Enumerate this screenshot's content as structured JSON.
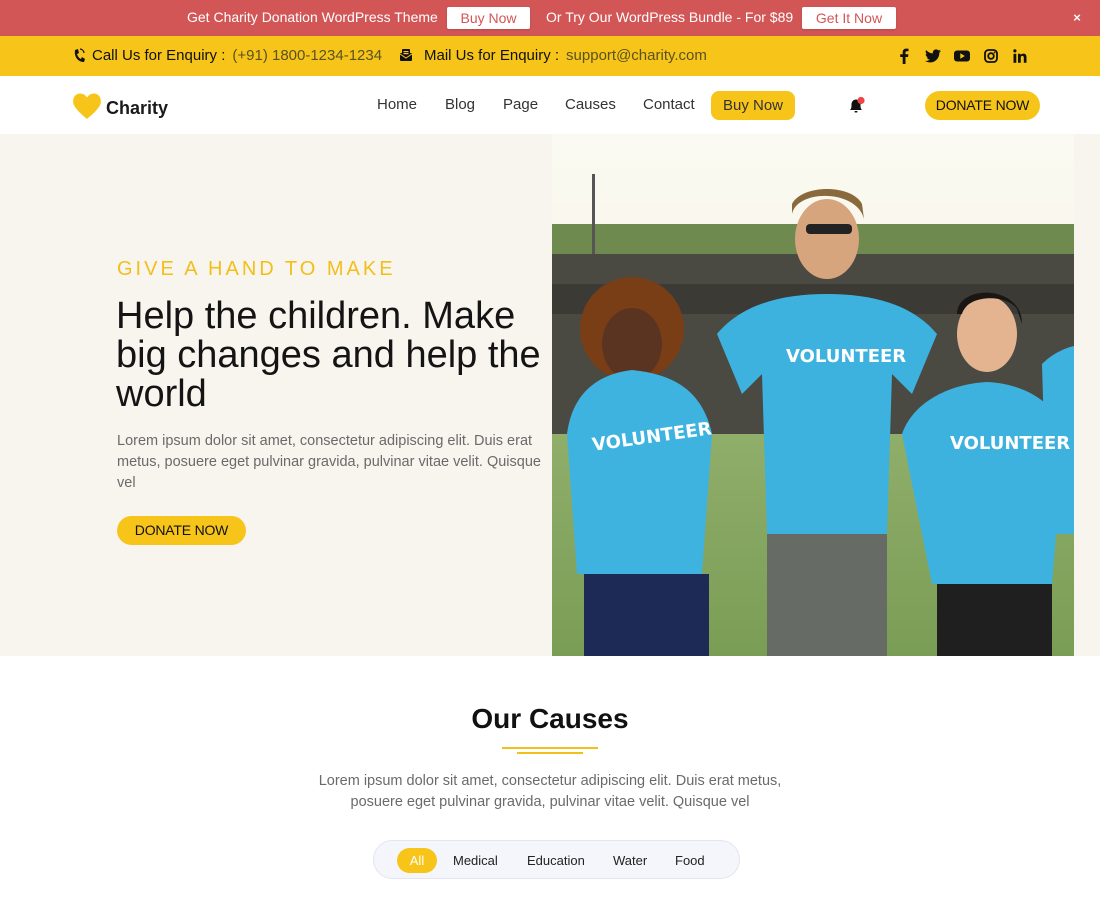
{
  "promo_bar": {
    "text1": "Get Charity Donation WordPress Theme",
    "button1": "Buy Now",
    "text2": "Or Try Our WordPress Bundle - For $89",
    "button2": "Get It Now",
    "close": "×",
    "background": "#d35657"
  },
  "contact_bar": {
    "phone_label": "Call Us for Enquiry :",
    "phone_value": "(+91) 1800-1234-1234",
    "phone_icon": "phone-icon",
    "mail_label": "Mail Us for Enquiry :",
    "mail_value": "support@charity.com",
    "mail_icon": "mail-icon",
    "socials": [
      "facebook-icon",
      "twitter-icon",
      "youtube-icon",
      "instagram-icon",
      "linkedin-icon"
    ],
    "background": "#f7c519"
  },
  "nav": {
    "logo_text": "Charity",
    "logo_icon": "heart-icon",
    "links": [
      "Home",
      "Blog",
      "Page",
      "Causes",
      "Contact"
    ],
    "buy_now": "Buy Now",
    "notification_icon": "bell-icon",
    "donate": "DONATE NOW",
    "accent": "#f7c519"
  },
  "hero": {
    "eyebrow": "GIVE A HAND TO MAKE",
    "title": "Help the children. Make big changes and help the world",
    "description": "Lorem ipsum dolor sit amet, consectetur adipiscing elit. Duis erat metus, posuere eget pulvinar gravida, pulvinar vitae velit. Quisque vel",
    "donate": "DONATE NOW",
    "photo_alt": "Volunteers in blue VOLUNTEER t-shirts walking together",
    "shirt_text": "VOLUNTEER"
  },
  "causes": {
    "title": "Our Causes",
    "description": "Lorem ipsum dolor sit amet, consectetur adipiscing elit. Duis erat metus, posuere eget pulvinar gravida, pulvinar vitae velit. Quisque vel",
    "filters": [
      "All",
      "Medical",
      "Education",
      "Water",
      "Food"
    ],
    "active_filter": "All"
  }
}
